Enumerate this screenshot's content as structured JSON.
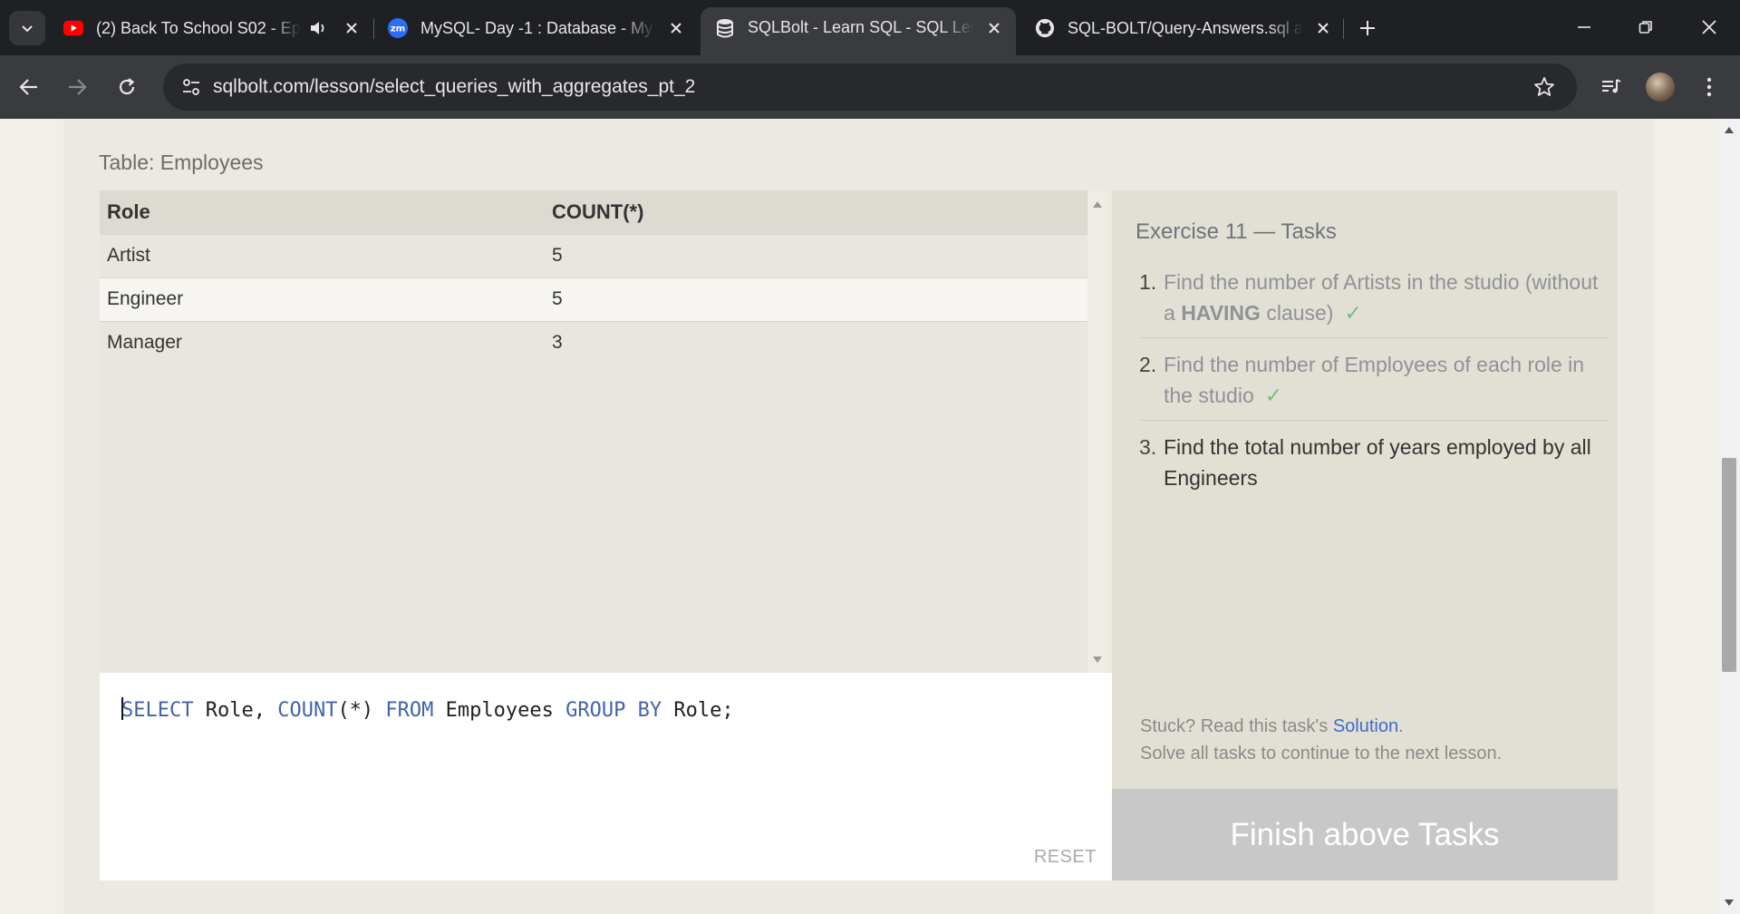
{
  "browser": {
    "tabs": [
      {
        "title": "(2) Back To School S02 - Ep",
        "favicon": "youtube-icon"
      },
      {
        "title": "MySQL- Day -1 : Database - My",
        "favicon": "zoom-icon",
        "favicon_text": "zm"
      },
      {
        "title": "SQLBolt - Learn SQL - SQL Lesso",
        "favicon": "database-icon",
        "active": true
      },
      {
        "title": "SQL-BOLT/Query-Answers.sql at",
        "favicon": "github-icon"
      }
    ],
    "url": "sqlbolt.com/lesson/select_queries_with_aggregates_pt_2"
  },
  "table": {
    "caption": "Table: Employees",
    "columns": [
      "Role",
      "COUNT(*)"
    ],
    "rows": [
      [
        "Artist",
        "5"
      ],
      [
        "Engineer",
        "5"
      ],
      [
        "Manager",
        "3"
      ]
    ]
  },
  "editor": {
    "tokens": [
      "SELECT",
      " Role, ",
      "COUNT",
      "(*) ",
      "FROM",
      " Employees ",
      "GROUP",
      " ",
      "BY",
      " Role;"
    ],
    "reset_label": "RESET"
  },
  "exercise": {
    "title": "Exercise 11 — Tasks",
    "tasks": [
      {
        "num": "1.",
        "text_before": "Find the number of Artists in the studio (without a ",
        "bold": "HAVING",
        "text_after": " clause)",
        "done": true,
        "check": "✓"
      },
      {
        "num": "2.",
        "text_before": "Find the number of Employees of each role in the studio",
        "done": true,
        "check": "✓"
      },
      {
        "num": "3.",
        "text_before": "Find the total number of years employed by all Engineers",
        "done": false
      }
    ],
    "stuck_prefix": "Stuck? Read this task's ",
    "solution_link": "Solution",
    "stuck_suffix": ".",
    "stuck_line2": "Solve all tasks to continue to the next lesson.",
    "finish_label": "Finish above Tasks"
  },
  "colors": {
    "keyword": "#4363a8",
    "check": "#7dbb7d",
    "link": "#3b6ec7"
  }
}
